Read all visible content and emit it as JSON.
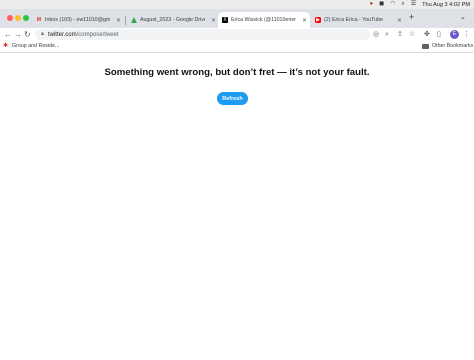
{
  "menubar": {
    "clock": "Thu Aug 3  4:02 PM",
    "icons": [
      "status-icon",
      "app-icon",
      "wifi-icon",
      "search-icon",
      "control-center-icon"
    ]
  },
  "tabs": [
    {
      "title": "Inbox (103) - ew11010@gmail...",
      "icon": "gmail-icon",
      "active": false
    },
    {
      "title": "August_2023 - Google Drive",
      "icon": "google-drive-icon",
      "active": false
    },
    {
      "title": "Erica Wissick (@11010erien) /",
      "icon": "x-icon",
      "active": true
    },
    {
      "title": "(2) Erica Erica - YouTube",
      "icon": "youtube-icon",
      "active": false
    }
  ],
  "toolbar": {
    "url_host": "twitter.com",
    "url_path": "/compose/tweet",
    "profile_initial": "E"
  },
  "bookmarks": {
    "first": "Group and Reside...",
    "other": "Other Bookmarks"
  },
  "page": {
    "error_message": "Something went wrong, but don’t fret — it’s not your fault.",
    "refresh_label": "Refresh"
  },
  "colors": {
    "accent": "#1d9bf0",
    "tabstrip": "#dee1e6"
  }
}
